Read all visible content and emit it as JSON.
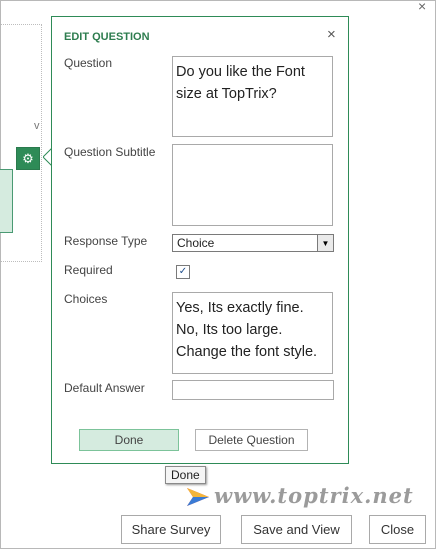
{
  "window": {
    "close_glyph": "×"
  },
  "background": {
    "letter": "v"
  },
  "dialog": {
    "title": "EDIT QUESTION",
    "close_glyph": "×",
    "fields": {
      "question_label": "Question",
      "question_value": "Do you like the Font size at TopTrix?",
      "subtitle_label": "Question Subtitle",
      "subtitle_value": "",
      "response_type_label": "Response Type",
      "response_type_value": "Choice",
      "required_label": "Required",
      "required_checked": true,
      "choices_label": "Choices",
      "choices_value": "Yes, Its exactly fine.\nNo, Its too large.\nChange the font style.",
      "default_answer_label": "Default Answer",
      "default_answer_value": ""
    },
    "buttons": {
      "done": "Done",
      "delete": "Delete Question"
    }
  },
  "tooltip": {
    "text": "Done"
  },
  "watermark": {
    "text": "www.toptrix.net"
  },
  "footer": {
    "share": "Share Survey",
    "save": "Save and View",
    "close": "Close"
  },
  "icons": {
    "gear": "gear-icon",
    "dropdown": "chevron-down-icon",
    "check": "checkmark-icon"
  },
  "colors": {
    "accent": "#2e8b57",
    "button_fill": "#d5ebdf"
  }
}
